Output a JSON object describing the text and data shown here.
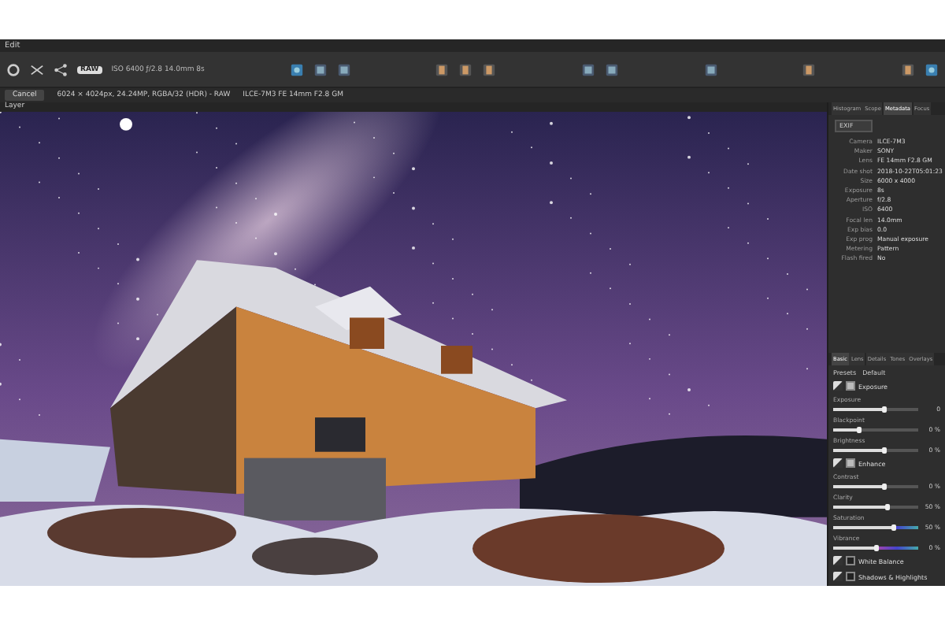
{
  "menu": [
    "Edit"
  ],
  "toolbar": {
    "raw_badge": "RAW",
    "exposure_info": "ISO 6400 ƒ/2.8 14.0mm 8s"
  },
  "context_bar": {
    "cancel": "Cancel",
    "image_info": "6024 × 4024px, 24.24MP, RGBA/32 (HDR) - RAW",
    "lens_info": "ILCE-7M3 FE 14mm F2.8 GM"
  },
  "canvas": {
    "layer_label": "Layer"
  },
  "panel_tabs": [
    {
      "label": "Histogram",
      "selected": false
    },
    {
      "label": "Scope",
      "selected": false
    },
    {
      "label": "Metadata",
      "selected": true
    },
    {
      "label": "Focus",
      "selected": false
    }
  ],
  "metadata": {
    "dropdown": "EXIF",
    "rows": [
      {
        "label": "Camera",
        "value": "ILCE-7M3"
      },
      {
        "label": "Maker",
        "value": "SONY"
      },
      {
        "label": "Lens",
        "value": "FE 14mm F2.8 GM"
      },
      {
        "label": "Date shot",
        "value": "2018-10-22T05:01:23"
      },
      {
        "label": "Size",
        "value": "6000 x 4000"
      },
      {
        "label": "Exposure",
        "value": "8s"
      },
      {
        "label": "Aperture",
        "value": "f/2.8"
      },
      {
        "label": "ISO",
        "value": "6400"
      },
      {
        "label": "Focal len",
        "value": "14.0mm"
      },
      {
        "label": "Exp bias",
        "value": "0.0"
      },
      {
        "label": "Exp prog",
        "value": "Manual exposure"
      },
      {
        "label": "Metering",
        "value": "Pattern"
      },
      {
        "label": "Flash fired",
        "value": "No"
      }
    ]
  },
  "develop_tabs": [
    {
      "label": "Basic",
      "selected": true
    },
    {
      "label": "Lens",
      "selected": false
    },
    {
      "label": "Details",
      "selected": false
    },
    {
      "label": "Tones",
      "selected": false
    },
    {
      "label": "Overlays",
      "selected": false
    }
  ],
  "presets": {
    "label": "Presets",
    "value": "Default"
  },
  "sections": [
    {
      "title": "Exposure",
      "checked": true,
      "sliders": [
        {
          "name": "Exposure",
          "level": 0.6,
          "reading": "0",
          "kind": "gray"
        },
        {
          "name": "Blackpoint",
          "level": 0.3,
          "reading": "0 %",
          "kind": "gray"
        },
        {
          "name": "Brightness",
          "level": 0.6,
          "reading": "0 %",
          "kind": "gray"
        }
      ]
    },
    {
      "title": "Enhance",
      "checked": true,
      "sliders": [
        {
          "name": "Contrast",
          "level": 0.6,
          "reading": "0 %",
          "kind": "gray"
        },
        {
          "name": "Clarity",
          "level": 0.64,
          "reading": "50 %",
          "kind": "gray"
        },
        {
          "name": "Saturation",
          "level": 0.72,
          "reading": "50 %",
          "kind": "color"
        },
        {
          "name": "Vibrance",
          "level": 0.5,
          "reading": "0 %",
          "kind": "color"
        }
      ]
    },
    {
      "title": "White Balance",
      "checked": false
    },
    {
      "title": "Shadows & Highlights",
      "checked": false
    }
  ]
}
